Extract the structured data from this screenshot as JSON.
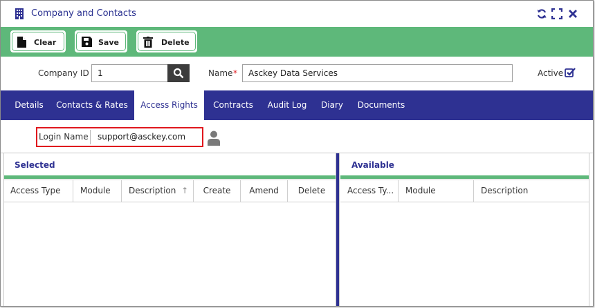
{
  "window": {
    "title": "Company and Contacts",
    "title_icon": "building-icon",
    "controls": [
      "refresh-icon",
      "expand-icon",
      "close-icon"
    ]
  },
  "toolbar": {
    "clear_label": "Clear",
    "save_label": "Save",
    "delete_label": "Delete"
  },
  "form": {
    "company_id_label": "Company ID",
    "company_id_value": "1",
    "name_label": "Name",
    "required_marker": "*",
    "name_value": "Asckey Data Services",
    "active_label": "Active",
    "active_checked": true
  },
  "tabs": [
    {
      "label": "Details",
      "active": false
    },
    {
      "label": "Contacts & Rates",
      "active": false
    },
    {
      "label": "Access Rights",
      "active": true
    },
    {
      "label": "Contracts",
      "active": false
    },
    {
      "label": "Audit Log",
      "active": false
    },
    {
      "label": "Diary",
      "active": false
    },
    {
      "label": "Documents",
      "active": false
    }
  ],
  "login": {
    "label": "Login Name",
    "value": "support@asckey.com"
  },
  "selected_panel": {
    "title": "Selected",
    "columns": [
      "Access Type",
      "Module",
      "Description",
      "Create",
      "Amend",
      "Delete"
    ],
    "sort_indicator": "↑"
  },
  "available_panel": {
    "title": "Available",
    "columns": [
      "Access Ty...",
      "Module",
      "Description"
    ]
  },
  "colors": {
    "primary": "#2e3192",
    "green": "#5eb87a",
    "highlight": "#e0171d"
  }
}
